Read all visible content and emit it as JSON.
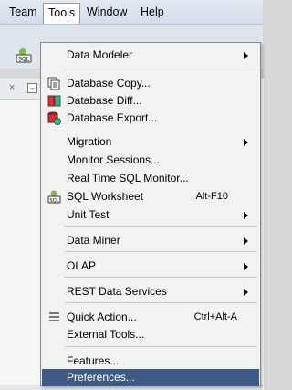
{
  "menubar": {
    "team": "Team",
    "tools": "Tools",
    "window": "Window",
    "help": "Help"
  },
  "tools_menu": {
    "items": [
      {
        "label": "Data Modeler",
        "submenu": true
      },
      {
        "label": "Database Copy...",
        "icon": "database-copy-icon"
      },
      {
        "label": "Database Diff...",
        "icon": "database-diff-icon"
      },
      {
        "label": "Database Export...",
        "icon": "database-export-icon"
      },
      {
        "label": "Migration",
        "submenu": true
      },
      {
        "label": "Monitor Sessions..."
      },
      {
        "label": "Real Time SQL Monitor..."
      },
      {
        "label": "SQL Worksheet",
        "icon": "sql-worksheet-icon",
        "accelerator": "Alt-F10"
      },
      {
        "label": "Unit Test",
        "submenu": true
      },
      {
        "label": "Data Miner",
        "submenu": true
      },
      {
        "label": "OLAP",
        "submenu": true
      },
      {
        "label": "REST Data Services",
        "submenu": true
      },
      {
        "label": "Quick Action...",
        "icon": "quick-action-icon",
        "accelerator": "Ctrl+Alt-A"
      },
      {
        "label": "External Tools..."
      },
      {
        "label": "Features..."
      },
      {
        "label": "Preferences...",
        "selected": true
      }
    ]
  }
}
